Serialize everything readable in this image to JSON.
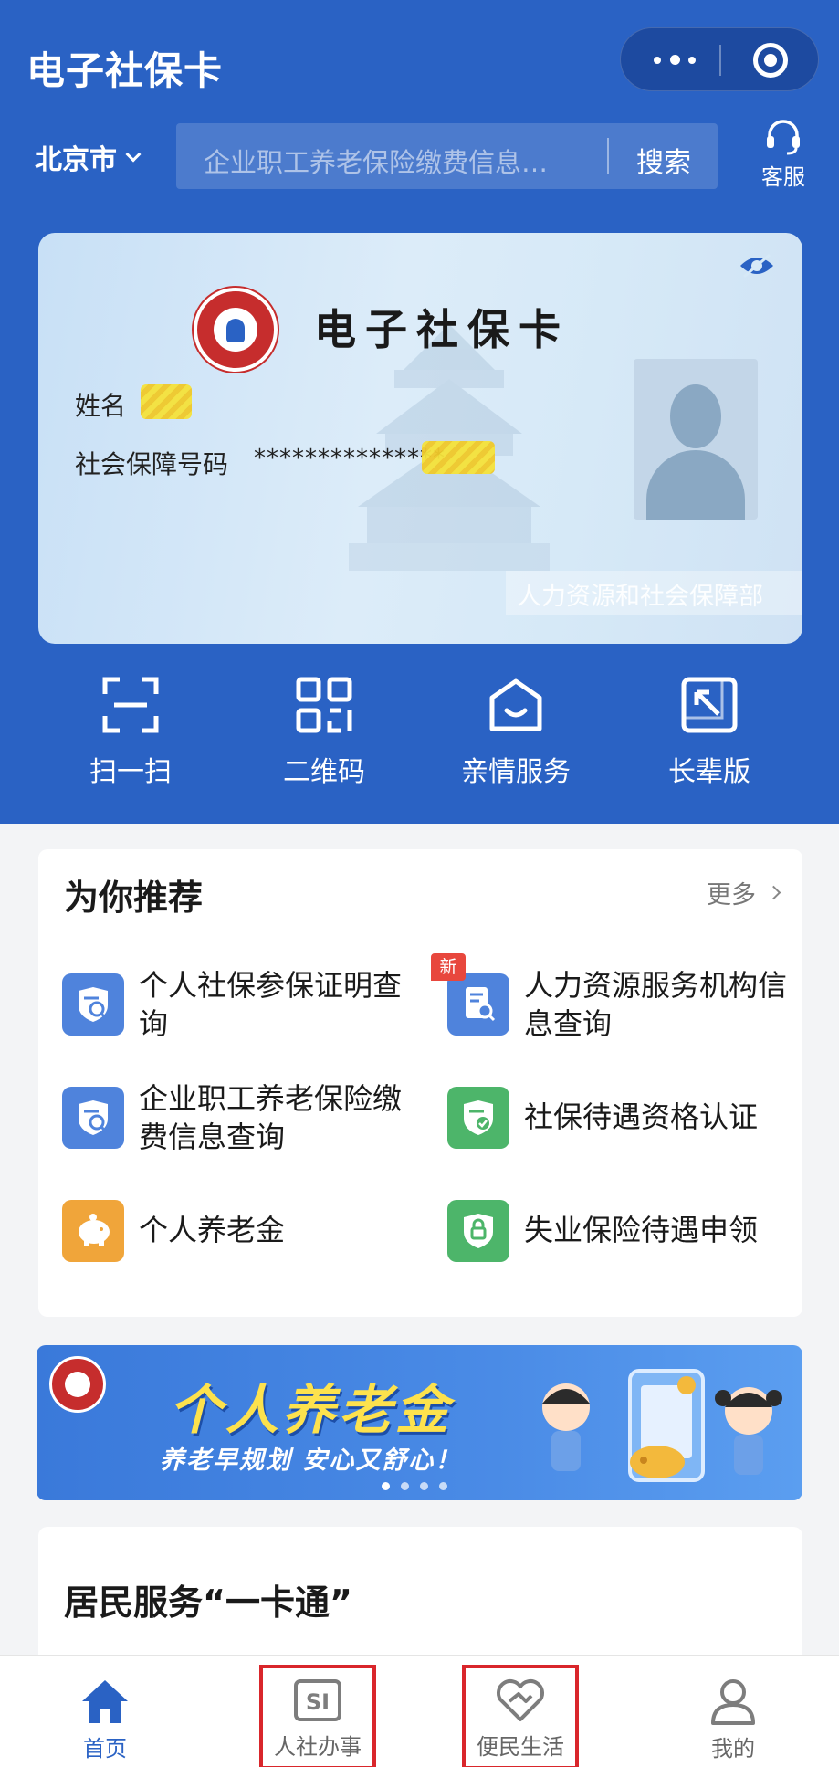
{
  "header": {
    "title": "电子社保卡",
    "city": "北京市",
    "search_placeholder": "企业职工养老保险缴费信息…",
    "search_button": "搜索",
    "customer_service": "客服"
  },
  "card": {
    "title": "电子社保卡",
    "name_label": "姓名",
    "ssn_label": "社会保障号码",
    "ssn_value": "***************",
    "issuer": "人力资源和社会保障部"
  },
  "quick_actions": [
    {
      "label": "扫一扫",
      "icon": "scan-icon"
    },
    {
      "label": "二维码",
      "icon": "qrcode-icon"
    },
    {
      "label": "亲情服务",
      "icon": "family-service-icon"
    },
    {
      "label": "长辈版",
      "icon": "elder-mode-icon"
    }
  ],
  "recommend": {
    "title": "为你推荐",
    "more": "更多",
    "new_badge": "新",
    "items": [
      {
        "label": "个人社保参保证明查询",
        "icon": "certificate-search-icon",
        "color": "#4f83dc"
      },
      {
        "label": "人力资源服务机构信息查询",
        "icon": "document-search-icon",
        "color": "#4f83dc",
        "badge": "新"
      },
      {
        "label": "企业职工养老保险缴费信息查询",
        "icon": "payment-search-icon",
        "color": "#4f83dc"
      },
      {
        "label": "社保待遇资格认证",
        "icon": "shield-check-icon",
        "color": "#4db56a"
      },
      {
        "label": "个人养老金",
        "icon": "piggy-bank-icon",
        "color": "#f0a53a"
      },
      {
        "label": "失业保险待遇申领",
        "icon": "shield-lock-icon",
        "color": "#4db56a"
      }
    ]
  },
  "banner": {
    "title": "个人养老金",
    "subtitle": "养老早规划 安心又舒心！",
    "page_count": 4,
    "active_page": 1
  },
  "resident": {
    "title": "居民服务“一卡通”"
  },
  "tabbar": [
    {
      "label": "首页",
      "icon": "home-icon",
      "active": true
    },
    {
      "label": "人社办事",
      "icon": "si-icon",
      "highlighted": true
    },
    {
      "label": "便民生活",
      "icon": "heart-hands-icon",
      "highlighted": true
    },
    {
      "label": "我的",
      "icon": "user-icon"
    }
  ],
  "colors": {
    "primary_blue": "#2a62c4",
    "highlight_red": "#d9262b",
    "banner_yellow": "#fde24d"
  }
}
